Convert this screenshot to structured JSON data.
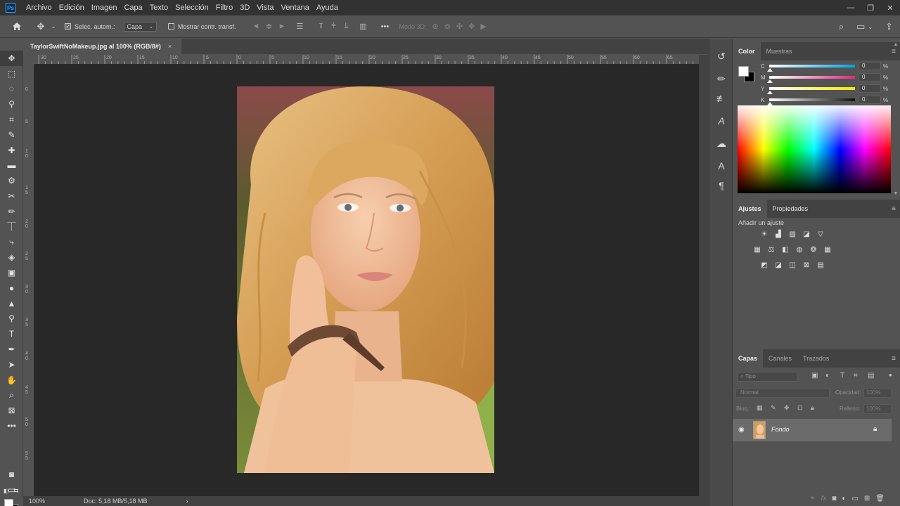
{
  "app": {
    "logo": "Ps",
    "menu": [
      "Archivo",
      "Edición",
      "Imagen",
      "Capa",
      "Texto",
      "Selección",
      "Filtro",
      "3D",
      "Vista",
      "Ventana",
      "Ayuda"
    ],
    "window_controls": [
      "minimize-icon",
      "restore-icon",
      "close-icon"
    ]
  },
  "options_bar": {
    "auto_select_label": "Selec. autom.:",
    "auto_select_checked": true,
    "auto_select_target": "Capa",
    "show_transform_label": "Mostrar contr. transf.",
    "show_transform_checked": false,
    "more_label": "•••",
    "mode3d_label": "Modo 3D:"
  },
  "document": {
    "tab_title": "TaylorSwiftNoMakeup.jpg al 100% (RGB/8#)",
    "tab_close": "×",
    "zoom": "100%",
    "doc_info": "Doc: 5,18 MB/5,18 MB",
    "status_arrow": "›"
  },
  "ruler_top": [
    "30",
    "25",
    "20",
    "15",
    "10",
    "5",
    "0",
    "5",
    "10",
    "15",
    "20",
    "25",
    "30",
    "35",
    "40",
    "45",
    "50",
    "55",
    "60",
    "65"
  ],
  "ruler_left": [
    "0",
    "5",
    "1\n0",
    "1\n5",
    "2\n0",
    "2\n5",
    "3\n0",
    "3\n5",
    "4\n0",
    "4\n5",
    "5\n0",
    "5\n5"
  ],
  "tools": [
    "move-icon",
    "marquee-icon",
    "lasso-icon",
    "magic-wand-icon",
    "crop-icon",
    "eyedropper-icon",
    "healing-icon",
    "patch-icon",
    "stamp-icon",
    "scissors-icon",
    "brush-icon",
    "clone-stamp-icon",
    "history-brush-icon",
    "eraser-icon",
    "gradient-icon",
    "blur-icon",
    "dodge-icon",
    "smudge-icon",
    "type-icon",
    "pen-icon",
    "path-select-icon",
    "hand-icon",
    "zoom-icon",
    "more-tools-icon"
  ],
  "color_panel": {
    "tabs": [
      "Color",
      "Muestras"
    ],
    "sliders": [
      {
        "letter": "C",
        "value": "0",
        "unit": "%"
      },
      {
        "letter": "M",
        "value": "0",
        "unit": "%"
      },
      {
        "letter": "Y",
        "value": "0",
        "unit": "%"
      },
      {
        "letter": "K",
        "value": "0",
        "unit": "%"
      }
    ],
    "foreground": "#ffffff",
    "background": "#000000"
  },
  "adjust_panel": {
    "tabs": [
      "Ajustes",
      "Propiedades"
    ],
    "title": "Añadir un ajuste"
  },
  "layers_panel": {
    "tabs": [
      "Capas",
      "Canales",
      "Trazados"
    ],
    "search_placeholder": "Tipo",
    "blend_mode": "Normal",
    "opacity_label": "Opacidad:",
    "opacity_value": "100%",
    "lock_label": "Bloq.:",
    "fill_label": "Relleno:",
    "fill_value": "100%",
    "layers": [
      {
        "name": "Fondo",
        "visible": true,
        "locked": true
      }
    ]
  }
}
